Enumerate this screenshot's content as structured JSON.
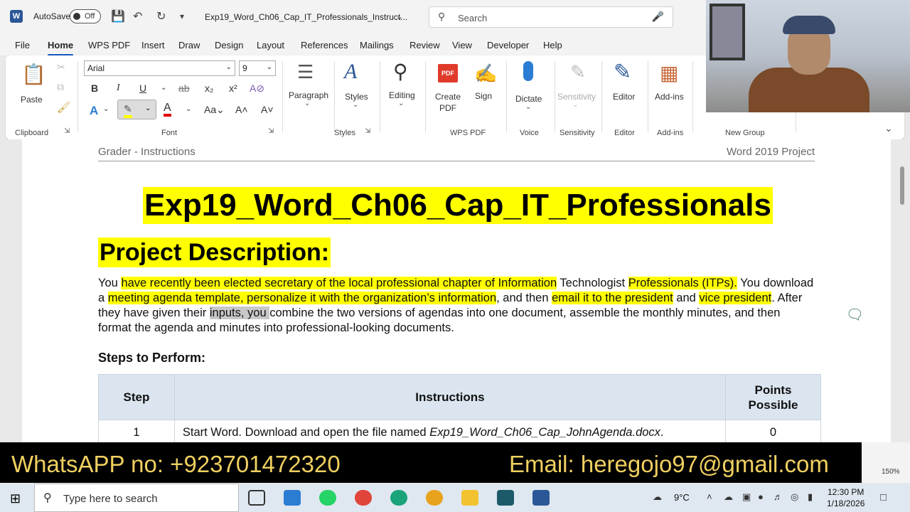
{
  "window": {
    "app_logo": "W",
    "autosave_label": "AutoSave",
    "autosave_state": "Off",
    "doc_title": "Exp19_Word_Ch06_Cap_IT_Professionals_Instruct...",
    "search_placeholder": "Search"
  },
  "menu": [
    "File",
    "Home",
    "WPS PDF",
    "Insert",
    "Draw",
    "Design",
    "Layout",
    "References",
    "Mailings",
    "Review",
    "View",
    "Developer",
    "Help"
  ],
  "ribbon": {
    "paste_label": "Paste",
    "clipboard_label": "Clipboard",
    "font_name": "Arial",
    "font_size": "9",
    "font_label": "Font",
    "paragraph_label": "Paragraph",
    "styles_btn": "Styles",
    "styles_label": "Styles",
    "editing_label": "Editing",
    "create_pdf_label": "Create PDF",
    "sign_label": "Sign",
    "wps_pdf_label": "WPS PDF",
    "dictate_label": "Dictate",
    "voice_label": "Voice",
    "sensitivity_btn": "Sensitivity",
    "sensitivity_label": "Sensitivity",
    "editor_btn": "Editor",
    "editor_label": "Editor",
    "addins_btn": "Add-ins",
    "addins_label": "Add-ins",
    "new_group_label": "New Group"
  },
  "document": {
    "header_left": "Grader - Instructions",
    "header_right": "Word 2019 Project",
    "title": "Exp19_Word_Ch06_Cap_IT_Professionals",
    "subtitle": "Project Description:",
    "para": {
      "s1": "You ",
      "s2": "have recently been elected secretary of the local professional chapter of Information",
      "s3": " Technologist ",
      "s4": "Professionals (ITPs).",
      "s5": " You download a ",
      "s6": "meeting agenda template, personalize it with the organization’s information",
      "s7": ", and then ",
      "s8": "email it to the president",
      "s9": " and ",
      "s10": "vice president",
      "s11": ". After they have given their ",
      "s12": "inputs, you ",
      "s13": "combine the two versions of agendas into one document, assemble the monthly minutes, and then format the agenda and minutes into professional-looking documents."
    },
    "steps_heading": "Steps to Perform:",
    "table": {
      "headers": [
        "Step",
        "Instructions",
        "Points Possible"
      ],
      "rows": [
        {
          "step": "1",
          "instr_pre": "Start Word. Download and open the file named ",
          "instr_file": "Exp19_Word_Ch06_Cap_JohnAgenda.docx",
          "instr_post": ".",
          "points": "0"
        }
      ]
    }
  },
  "banner": {
    "whatsapp": "WhatsAPP no: +923701472320",
    "email": "Email: heregojo97@gmail.com"
  },
  "statusbar": {
    "zoom": "150%"
  },
  "taskbar": {
    "search_placeholder": "Type here to search",
    "temperature": "9°C",
    "time": "12:30 PM",
    "date": "1/18/2026"
  },
  "colors": {
    "highlight": "#ffff00",
    "accent": "#185abd",
    "banner_text": "#f0d060"
  }
}
